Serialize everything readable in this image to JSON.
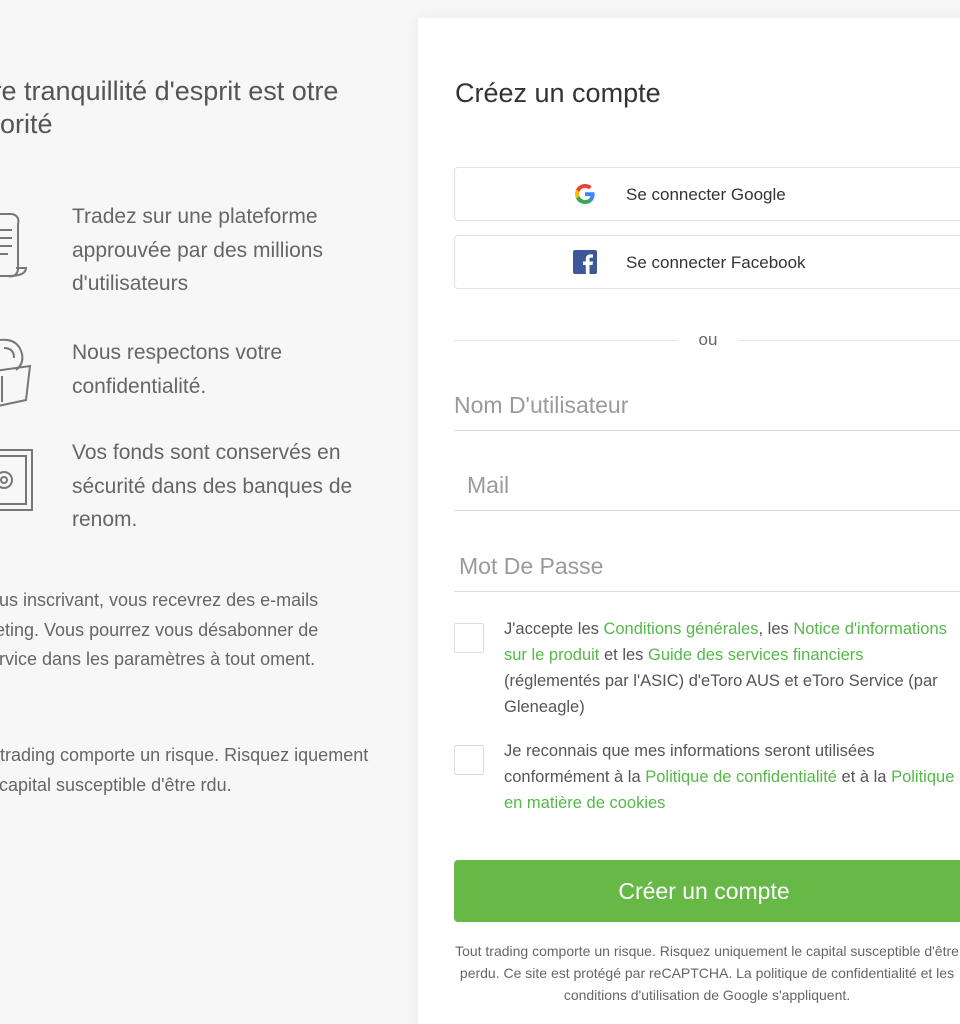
{
  "left": {
    "headline": "otre tranquillité d'esprit est otre priorité",
    "features": [
      {
        "icon": "document-icon",
        "text": "Tradez sur une plateforme approuvée par des millions d'utilisateurs"
      },
      {
        "icon": "privacy-icon",
        "text": "Nous respectons votre confidentialité."
      },
      {
        "icon": "safe-icon",
        "text": "Vos fonds sont conservés en sécurité dans des banques de renom."
      }
    ],
    "marketing_note": "vous inscrivant, vous recevrez des e-mails rketing. Vous pourrez vous désabonner de service dans les paramètres à tout oment.",
    "risk_note": "ut trading comporte un risque. Risquez iquement le capital susceptible d'être rdu."
  },
  "form": {
    "title": "Créez un compte",
    "google_button": "Se connecter Google",
    "facebook_button": "Se connecter Facebook",
    "divider": "ou",
    "username_placeholder": "Nom D'utilisateur",
    "email_placeholder": "Mail",
    "password_placeholder": "Mot De Passe",
    "terms": {
      "prefix": "J'accepte les ",
      "link1": "Conditions générales",
      "mid1": ", les ",
      "link2": "Notice d'informations sur le produit",
      "mid2": " et les ",
      "link3": "Guide des services financiers",
      "suffix": " (réglementés par l'ASIC) d'eToro AUS et eToro Service (par Gleneagle)"
    },
    "privacy": {
      "prefix": "Je reconnais que mes informations seront utilisées conformément à la ",
      "link1": "Politique de confidentialité",
      "mid": " et à la ",
      "link2": "Politique en matière de cookies"
    },
    "submit": "Créer un compte",
    "legal": "Tout trading comporte un risque. Risquez uniquement le capital susceptible d'être perdu. Ce site est protégé par reCAPTCHA. La politique de confidentialité et les conditions d'utilisation de Google s'appliquent."
  },
  "colors": {
    "accent": "#67b947",
    "link": "#54b948",
    "facebook": "#3b5998"
  }
}
